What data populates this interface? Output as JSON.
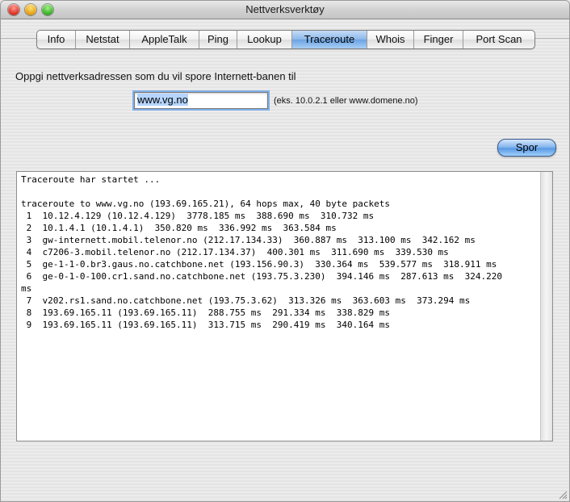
{
  "window": {
    "title": "Nettverksverktøy"
  },
  "tabs": [
    {
      "label": "Info"
    },
    {
      "label": "Netstat"
    },
    {
      "label": "AppleTalk"
    },
    {
      "label": "Ping"
    },
    {
      "label": "Lookup"
    },
    {
      "label": "Traceroute"
    },
    {
      "label": "Whois"
    },
    {
      "label": "Finger"
    },
    {
      "label": "Port Scan"
    }
  ],
  "active_tab": "Traceroute",
  "form": {
    "prompt": "Oppgi nettverksadressen som du vil spore Internett-banen til",
    "address_value": "www.vg.no",
    "hint": "(eks. 10.0.2.1 eller www.domene.no)",
    "submit_label": "Spor"
  },
  "output": {
    "lines": [
      "Traceroute har startet ...",
      "",
      "traceroute to www.vg.no (193.69.165.21), 64 hops max, 40 byte packets",
      " 1  10.12.4.129 (10.12.4.129)  3778.185 ms  388.690 ms  310.732 ms",
      " 2  10.1.4.1 (10.1.4.1)  350.820 ms  336.992 ms  363.584 ms",
      " 3  gw-internett.mobil.telenor.no (212.17.134.33)  360.887 ms  313.100 ms  342.162 ms",
      " 4  c7206-3.mobil.telenor.no (212.17.134.37)  400.301 ms  311.690 ms  339.530 ms",
      " 5  ge-1-1-0.br3.gaus.no.catchbone.net (193.156.90.3)  330.364 ms  539.577 ms  318.911 ms",
      " 6  ge-0-1-0-100.cr1.sand.no.catchbone.net (193.75.3.230)  394.146 ms  287.613 ms  324.220",
      "ms",
      " 7  v202.rs1.sand.no.catchbone.net (193.75.3.62)  313.326 ms  363.603 ms  373.294 ms",
      " 8  193.69.165.11 (193.69.165.11)  288.755 ms  291.334 ms  338.829 ms",
      " 9  193.69.165.11 (193.69.165.11)  313.715 ms  290.419 ms  340.164 ms"
    ]
  }
}
